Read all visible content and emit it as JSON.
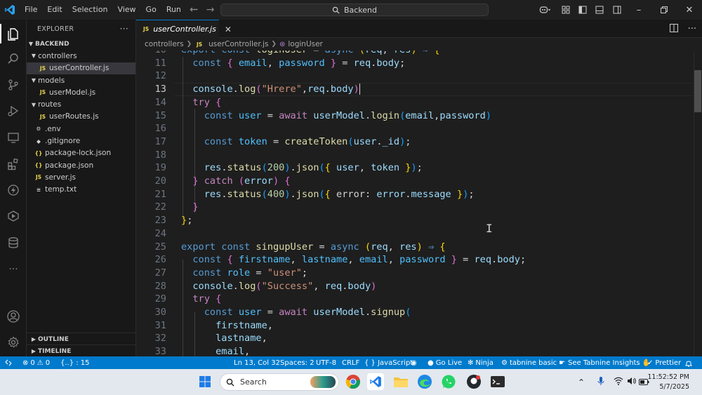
{
  "titlebar": {
    "menu": [
      "File",
      "Edit",
      "Selection",
      "View",
      "Go",
      "Run",
      "···"
    ],
    "search_text": "Backend"
  },
  "sidebar": {
    "title": "EXPLORER",
    "more": "···",
    "root": "BACKEND",
    "items": [
      {
        "label": "controllers",
        "type": "folder",
        "depth": 1
      },
      {
        "label": "userController.js",
        "type": "js",
        "depth": 2
      },
      {
        "label": "models",
        "type": "folder",
        "depth": 1
      },
      {
        "label": "userModel.js",
        "type": "js",
        "depth": 2
      },
      {
        "label": "routes",
        "type": "folder",
        "depth": 1
      },
      {
        "label": "userRoutes.js",
        "type": "js",
        "depth": 2
      },
      {
        "label": ".env",
        "type": "env",
        "depth": 1
      },
      {
        "label": ".gitignore",
        "type": "git",
        "depth": 1
      },
      {
        "label": "package-lock.json",
        "type": "json",
        "depth": 1
      },
      {
        "label": "package.json",
        "type": "json",
        "depth": 1
      },
      {
        "label": "server.js",
        "type": "js",
        "depth": 1
      },
      {
        "label": "temp.txt",
        "type": "txt",
        "depth": 1
      }
    ],
    "outline": "OUTLINE",
    "timeline": "TIMELINE"
  },
  "editor": {
    "tab_label": "userController.js",
    "tab_icon": "JS",
    "breadcrumb": [
      "controllers",
      "userController.js",
      "loginUser"
    ],
    "current_line": 13
  },
  "status": {
    "errors": "0",
    "warnings": "0",
    "selection": "{..} : 15",
    "position": "Ln 13, Col 32",
    "spaces": "Spaces: 2",
    "encoding": "UTF-8",
    "eol": "CRLF",
    "language": "{ } JavaScript",
    "golive": "Go Live",
    "ninja": "Ninja",
    "tabnine": "tabnine basic",
    "insights": "See Tabnine Insights",
    "prettier": "Prettier"
  },
  "taskbar": {
    "search_placeholder": "Search",
    "time": "11:52:52 PM",
    "date": "5/7/2025"
  },
  "colors": {
    "accent": "#007acc",
    "editor_bg": "#1e1e1e",
    "sidebar_bg": "#181818"
  }
}
